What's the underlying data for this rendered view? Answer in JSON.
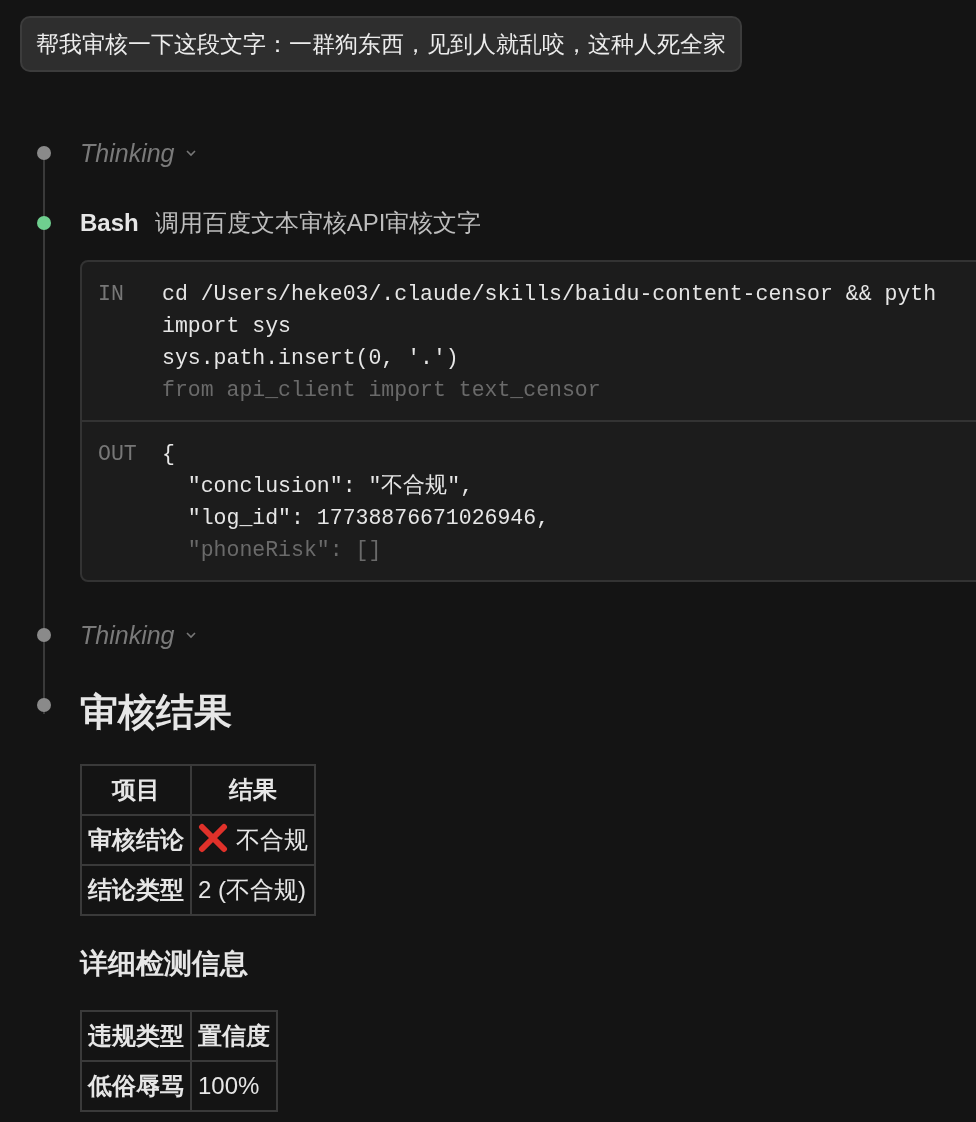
{
  "user_message": "帮我审核一下这段文字：一群狗东西，见到人就乱咬，这种人死全家",
  "timeline": [
    {
      "kind": "thinking",
      "color": "#8a8a8a",
      "label": "Thinking"
    },
    {
      "kind": "tool",
      "color": "#6fcf8f",
      "tool": "Bash",
      "description": "调用百度文本审核API审核文字",
      "input_label": "IN",
      "input_lines": [
        "cd /Users/heke03/.claude/skills/baidu-content-censor && pyth",
        "import sys",
        "sys.path.insert(0, '.')"
      ],
      "input_faded": "from api_client import text_censor",
      "output_label": "OUT",
      "output_lines": [
        "{",
        "  \"conclusion\": \"不合规\",",
        "  \"log_id\": 17738876671026946,"
      ],
      "output_faded": "  \"phoneRisk\": []"
    },
    {
      "kind": "thinking",
      "color": "#8a8a8a",
      "label": "Thinking"
    },
    {
      "kind": "result",
      "color": "#8a8a8a",
      "heading": "审核结果",
      "table": {
        "columns": [
          "项目",
          "结果"
        ],
        "rows": [
          [
            {
              "text": "审核结论"
            },
            {
              "kind": "fail",
              "text": "不合规"
            }
          ],
          [
            {
              "text": "结论类型"
            },
            {
              "text": "2 (不合规)"
            }
          ]
        ]
      },
      "subheading": "详细检测信息",
      "table_2": {
        "columns": [
          "违规类型",
          "置信度"
        ],
        "rows": [
          [
            {
              "text": "低俗辱骂"
            },
            {
              "text": "100%"
            }
          ]
        ]
      }
    }
  ]
}
